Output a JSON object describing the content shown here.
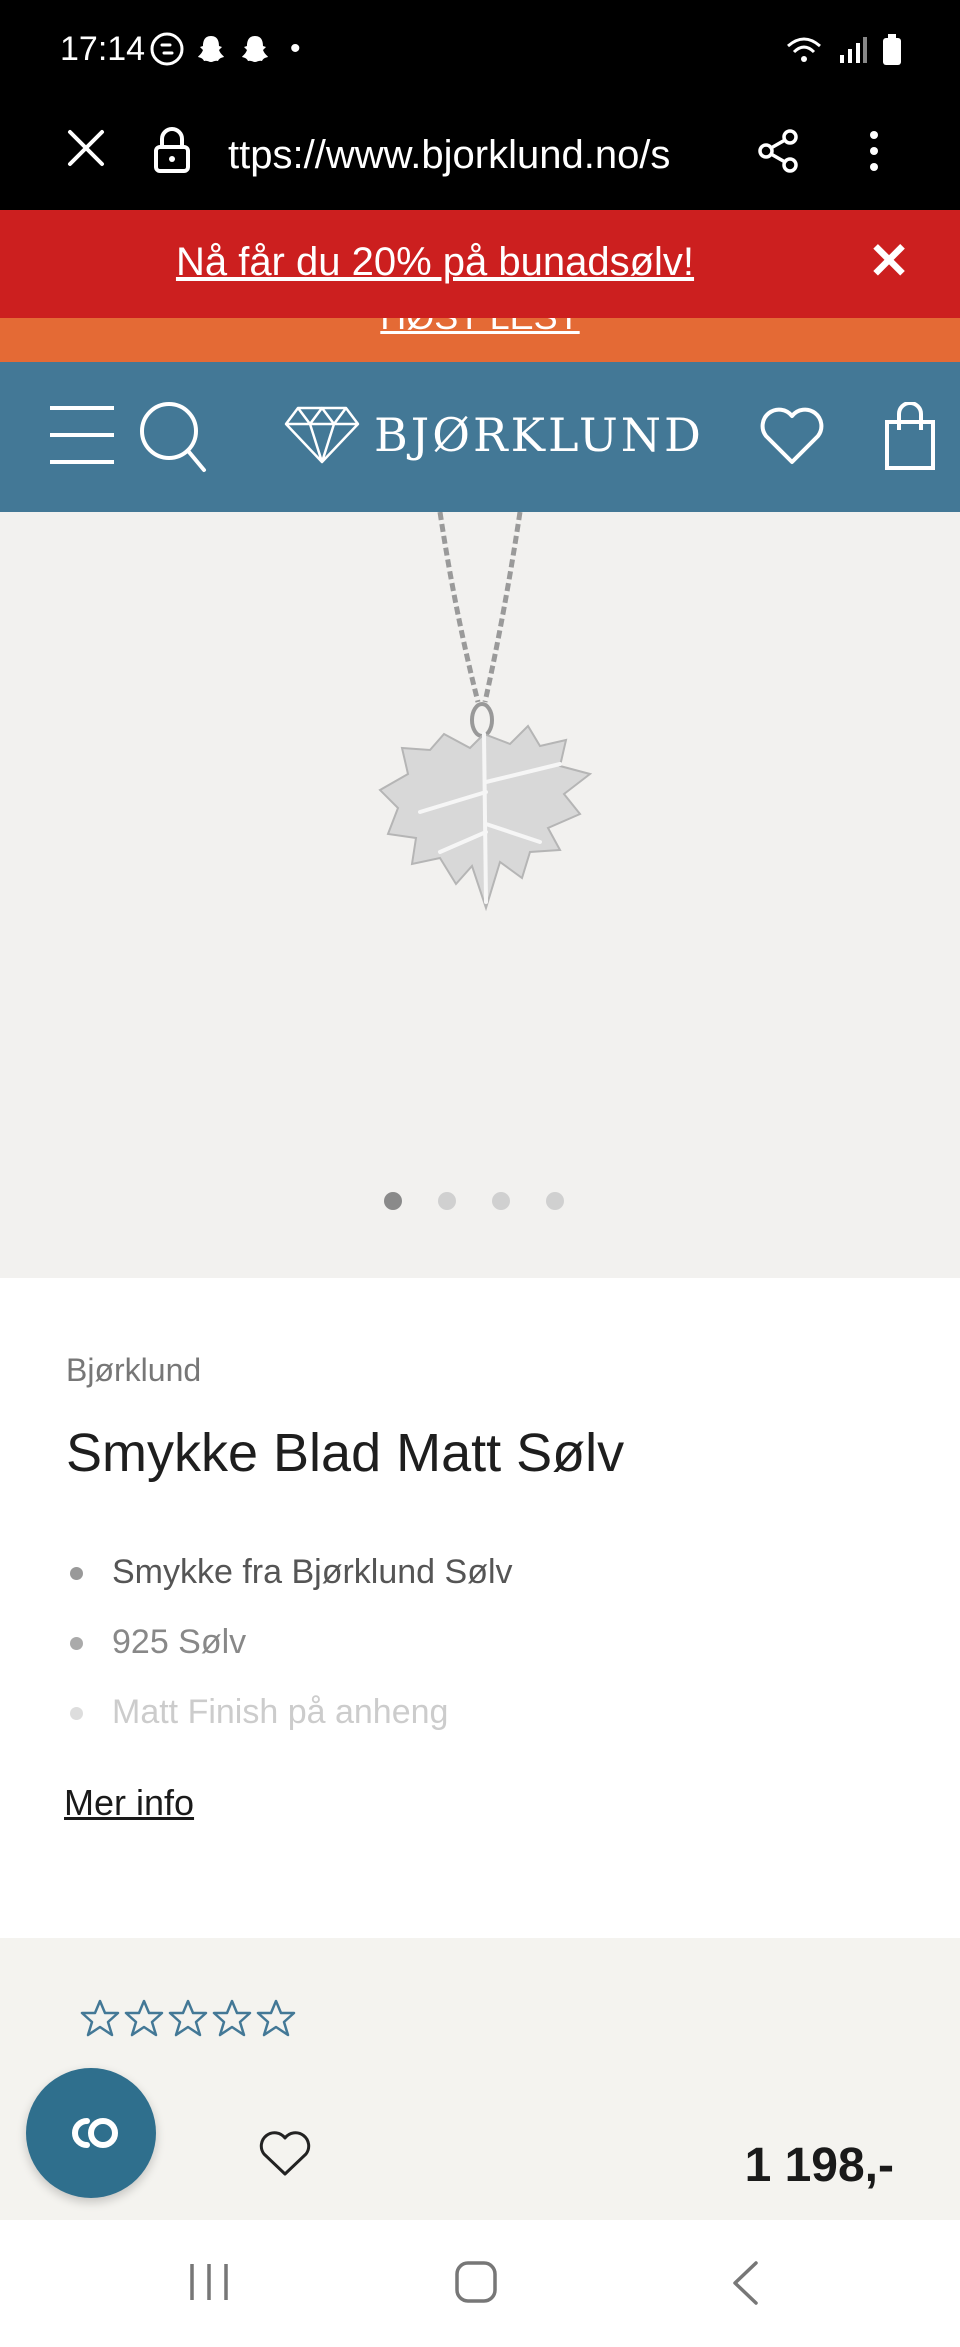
{
  "status_bar": {
    "time": "17:14",
    "dot": "•"
  },
  "browser": {
    "url": "ttps://www.bjorklund.no/s"
  },
  "promo": {
    "text": "Nå får du 20% på bunadsølv!",
    "close": "✕",
    "secondary_text": "HØST LEST"
  },
  "header": {
    "logo": "BJØRKLUND"
  },
  "gallery": {
    "image_count": 4,
    "active_index": 0
  },
  "product": {
    "brand": "Bjørklund",
    "title": "Smykke Blad Matt Sølv",
    "features": [
      "Smykke fra Bjørklund Sølv",
      "925 Sølv",
      "Matt Finish på anheng"
    ],
    "more_info": "Mer info",
    "rating": 0,
    "rating_max": 5,
    "price": "1 198,-"
  },
  "chat": {
    "label": "CO"
  },
  "colors": {
    "promo_red": "#cc1f1f",
    "promo_orange": "#e46a35",
    "header_blue": "#437896",
    "chat_blue": "#2f6f8d"
  }
}
